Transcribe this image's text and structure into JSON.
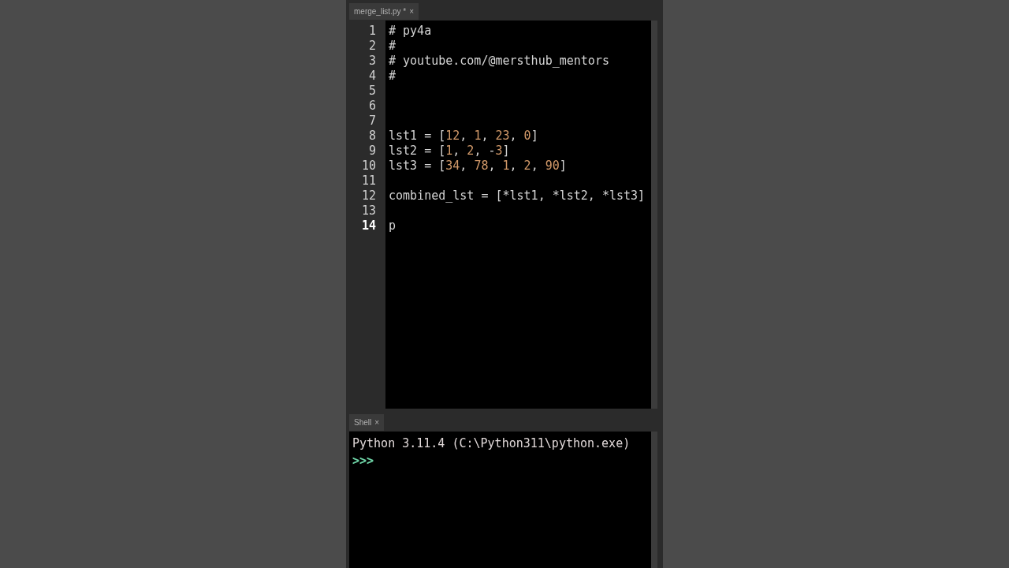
{
  "editor": {
    "tab": {
      "title": "merge_list.py *",
      "close": "×",
      "selected": true
    },
    "lines": [
      {
        "number": "1",
        "current": false,
        "tokens": [
          {
            "kind": "plain",
            "text": "# py4a"
          }
        ]
      },
      {
        "number": "2",
        "current": false,
        "tokens": [
          {
            "kind": "plain",
            "text": "#"
          }
        ]
      },
      {
        "number": "3",
        "current": false,
        "tokens": [
          {
            "kind": "plain",
            "text": "# youtube.com/@mersthub_mentors"
          }
        ]
      },
      {
        "number": "4",
        "current": false,
        "tokens": [
          {
            "kind": "plain",
            "text": "#"
          }
        ]
      },
      {
        "number": "5",
        "current": false
      },
      {
        "number": "6",
        "current": false
      },
      {
        "number": "7",
        "current": false
      },
      {
        "number": "8",
        "current": false,
        "tokens": [
          {
            "kind": "plain",
            "text": "lst1 = ["
          },
          {
            "kind": "number",
            "text": "12"
          },
          {
            "kind": "plain",
            "text": ", "
          },
          {
            "kind": "number",
            "text": "1"
          },
          {
            "kind": "plain",
            "text": ", "
          },
          {
            "kind": "number",
            "text": "23"
          },
          {
            "kind": "plain",
            "text": ", "
          },
          {
            "kind": "number",
            "text": "0"
          },
          {
            "kind": "plain",
            "text": "]"
          }
        ]
      },
      {
        "number": "9",
        "current": false,
        "tokens": [
          {
            "kind": "plain",
            "text": "lst2 = ["
          },
          {
            "kind": "number",
            "text": "1"
          },
          {
            "kind": "plain",
            "text": ", "
          },
          {
            "kind": "number",
            "text": "2"
          },
          {
            "kind": "plain",
            "text": ", -"
          },
          {
            "kind": "number",
            "text": "3"
          },
          {
            "kind": "plain",
            "text": "]"
          }
        ]
      },
      {
        "number": "10",
        "current": false,
        "tokens": [
          {
            "kind": "plain",
            "text": "lst3 = ["
          },
          {
            "kind": "number",
            "text": "34"
          },
          {
            "kind": "plain",
            "text": ", "
          },
          {
            "kind": "number",
            "text": "78"
          },
          {
            "kind": "plain",
            "text": ", "
          },
          {
            "kind": "number",
            "text": "1"
          },
          {
            "kind": "plain",
            "text": ", "
          },
          {
            "kind": "number",
            "text": "2"
          },
          {
            "kind": "plain",
            "text": ", "
          },
          {
            "kind": "number",
            "text": "90"
          },
          {
            "kind": "plain",
            "text": "]"
          }
        ]
      },
      {
        "number": "11",
        "current": false
      },
      {
        "number": "12",
        "current": false,
        "tokens": [
          {
            "kind": "plain",
            "text": "combined_lst = [*lst1, *lst2, *lst3]"
          }
        ]
      },
      {
        "number": "13",
        "current": false
      },
      {
        "number": "14",
        "current": true,
        "tokens": [
          {
            "kind": "plain",
            "text": "p"
          }
        ]
      }
    ]
  },
  "shell": {
    "tab": {
      "title": "Shell",
      "close": "×",
      "selected": true
    },
    "lines": [
      {
        "kind": "output",
        "text": "Python 3.11.4 (C:\\Python311\\python.exe)"
      },
      {
        "kind": "prompt",
        "text": ">>>"
      }
    ]
  }
}
